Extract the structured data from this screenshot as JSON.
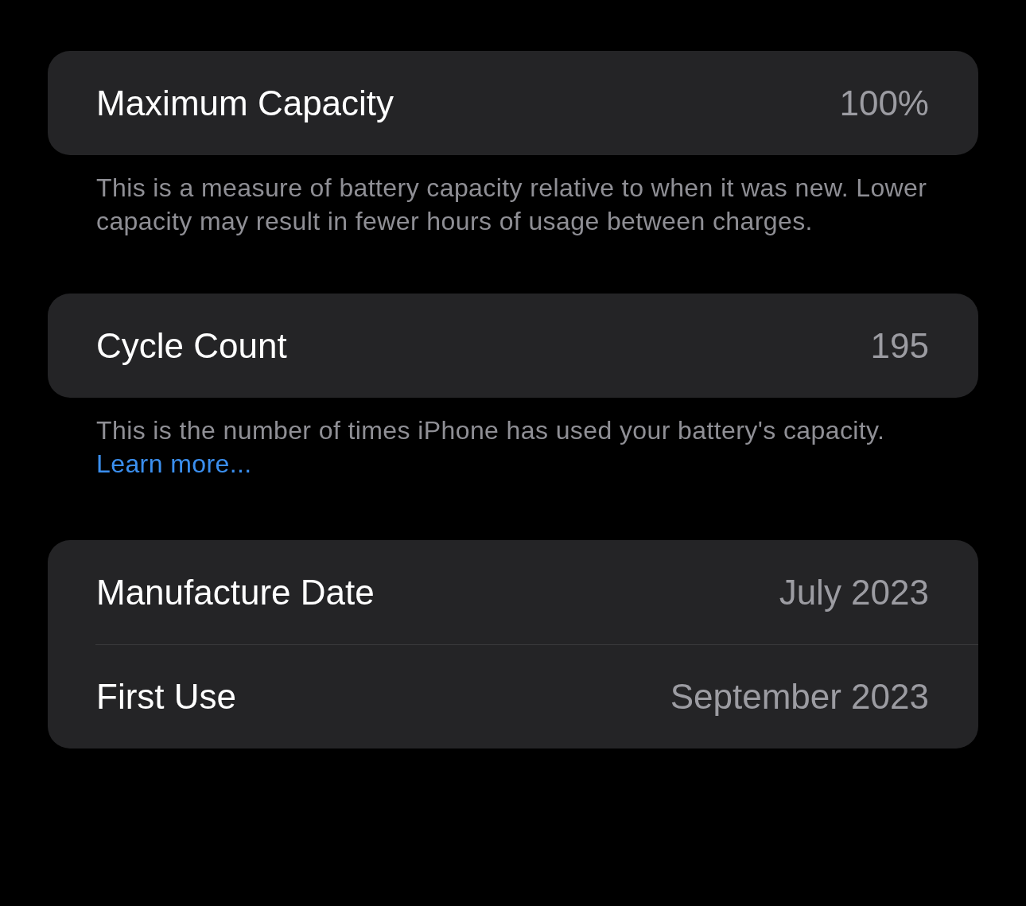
{
  "sections": [
    {
      "rows": [
        {
          "label": "Maximum Capacity",
          "value": "100%"
        }
      ],
      "footer": {
        "text": "This is a measure of battery capacity relative to when it was new. Lower capacity may result in fewer hours of usage between charges."
      }
    },
    {
      "rows": [
        {
          "label": "Cycle Count",
          "value": "195"
        }
      ],
      "footer": {
        "text": "This is the number of times iPhone has used your battery's capacity.",
        "link": "Learn more..."
      }
    },
    {
      "rows": [
        {
          "label": "Manufacture Date",
          "value": "July 2023"
        },
        {
          "label": "First Use",
          "value": "September 2023"
        }
      ]
    }
  ]
}
